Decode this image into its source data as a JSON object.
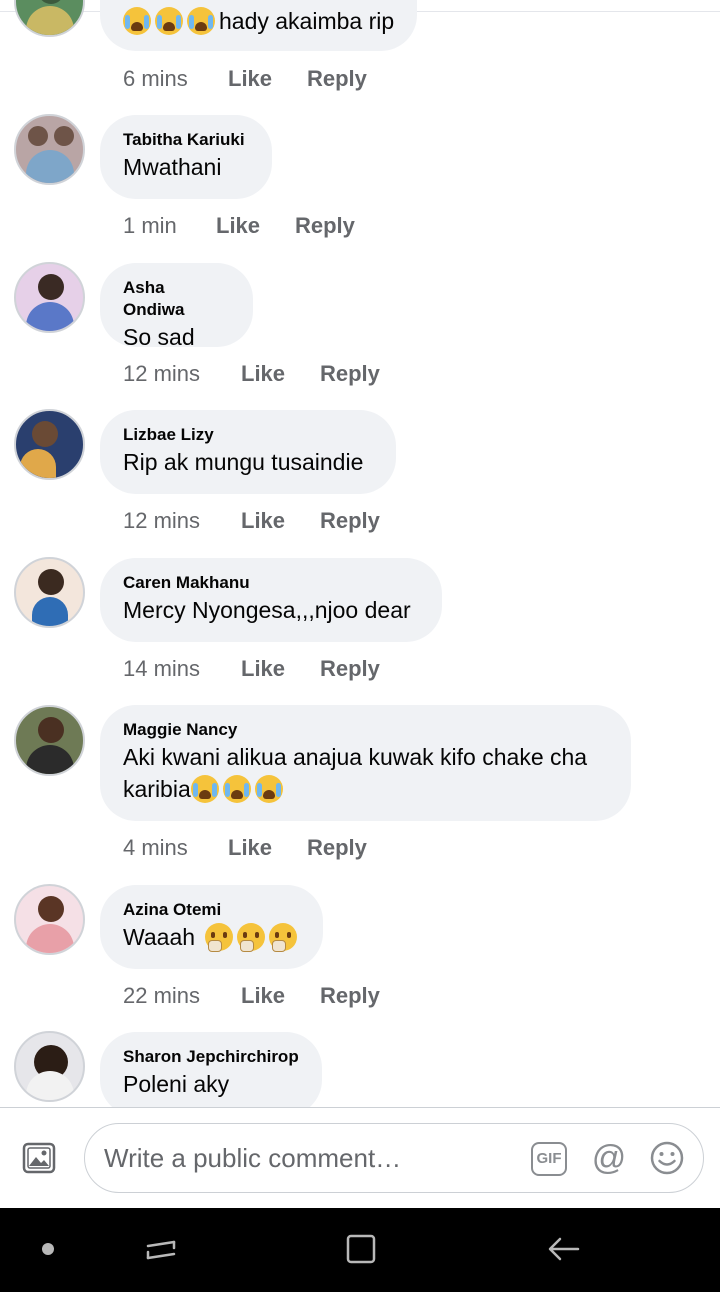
{
  "comments": [
    {
      "author": "",
      "text": "hady akaimba  rip",
      "emoji_prefix_count": 3,
      "time": "6 mins",
      "like": "Like",
      "reply": "Reply"
    },
    {
      "author": "Tabitha Kariuki",
      "text": "Mwathani",
      "time": "1 min",
      "like": "Like",
      "reply": "Reply"
    },
    {
      "author": "Asha Ondiwa",
      "text": "So sad",
      "time": "12 mins",
      "like": "Like",
      "reply": "Reply"
    },
    {
      "author": "Lizbae Lizy",
      "text": "Rip ak mungu tusaindie",
      "time": "12 mins",
      "like": "Like",
      "reply": "Reply"
    },
    {
      "author": "Caren Makhanu",
      "text": "Mercy Nyongesa,,,njoo dear",
      "time": "14 mins",
      "like": "Like",
      "reply": "Reply"
    },
    {
      "author": "Maggie Nancy",
      "text": "Aki kwani alikua anajua kuwak kifo chake cha karibia",
      "emoji_suffix_count": 3,
      "time": "4 mins",
      "like": "Like",
      "reply": "Reply"
    },
    {
      "author": "Azina Otemi",
      "text": "Waaah",
      "emoji_suffix_count": 3,
      "time": "22 mins",
      "like": "Like",
      "reply": "Reply"
    },
    {
      "author": "Sharon Jepchirchirop",
      "text": "Poleni aky"
    }
  ],
  "emojis": {
    "crying": "loudly-crying-face-emoji",
    "thinking": "thinking-face-emoji"
  },
  "composer": {
    "placeholder": "Write a public comment…",
    "gif_label": "GIF",
    "mention_symbol": "@",
    "icons": [
      "photo-icon",
      "gif-icon",
      "mention-icon",
      "emoji-icon"
    ]
  },
  "navigation": {
    "icons": [
      "dot-icon",
      "recent-apps-icon",
      "home-icon",
      "back-icon"
    ]
  },
  "colors": {
    "bubble": "#f0f2f5",
    "text": "#050505",
    "meta": "#65676b",
    "navbar": "#000000"
  }
}
